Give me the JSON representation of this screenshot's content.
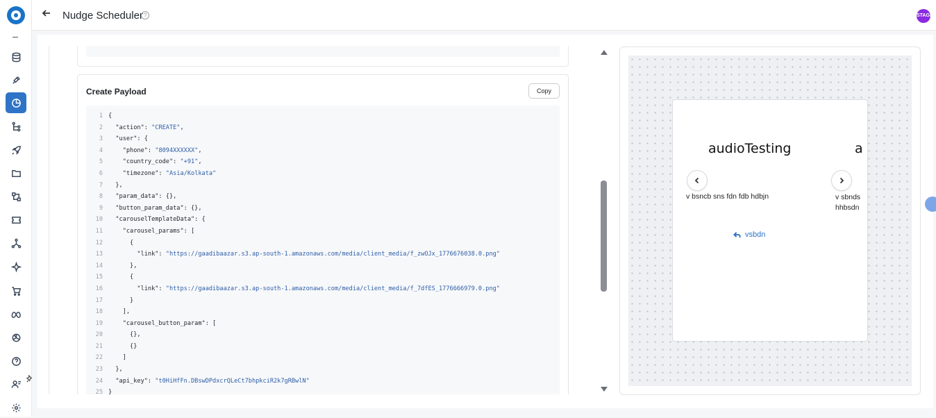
{
  "header": {
    "title": "Nudge Scheduler",
    "help": "?",
    "avatar_text": "STAGE"
  },
  "sidebar": {
    "items": [
      {
        "icon": "database-icon"
      },
      {
        "icon": "plug-icon"
      },
      {
        "icon": "pie-chart-icon",
        "active": true
      },
      {
        "icon": "flow-icon"
      },
      {
        "icon": "rocket-icon"
      },
      {
        "icon": "folder-icon"
      },
      {
        "icon": "workflow-icon"
      },
      {
        "icon": "ticket-icon"
      },
      {
        "icon": "network-icon"
      },
      {
        "icon": "sparkle-icon"
      },
      {
        "icon": "cart-icon"
      },
      {
        "icon": "meta-icon"
      },
      {
        "icon": "openai-icon"
      },
      {
        "icon": "help-icon"
      },
      {
        "icon": "agent-icon"
      },
      {
        "icon": "settings-icon"
      }
    ]
  },
  "payload": {
    "title": "Create Payload",
    "copy_label": "Copy",
    "lines": [
      {
        "n": "1",
        "parts": [
          [
            "k",
            "{"
          ]
        ]
      },
      {
        "n": "2",
        "parts": [
          [
            "k",
            "  \"action\": "
          ],
          [
            "s",
            "\"CREATE\""
          ],
          [
            "k",
            ","
          ]
        ]
      },
      {
        "n": "3",
        "parts": [
          [
            "k",
            "  \"user\": {"
          ]
        ]
      },
      {
        "n": "4",
        "parts": [
          [
            "k",
            "    \"phone\": "
          ],
          [
            "s",
            "\"8094XXXXXX\""
          ],
          [
            "k",
            ","
          ]
        ]
      },
      {
        "n": "5",
        "parts": [
          [
            "k",
            "    \"country_code\": "
          ],
          [
            "s",
            "\"+91\""
          ],
          [
            "k",
            ","
          ]
        ]
      },
      {
        "n": "6",
        "parts": [
          [
            "k",
            "    \"timezone\": "
          ],
          [
            "s",
            "\"Asia/Kolkata\""
          ]
        ]
      },
      {
        "n": "7",
        "parts": [
          [
            "k",
            "  },"
          ]
        ]
      },
      {
        "n": "8",
        "parts": [
          [
            "k",
            "  \"param_data\": {},"
          ]
        ]
      },
      {
        "n": "9",
        "parts": [
          [
            "k",
            "  \"button_param_data\": {},"
          ]
        ]
      },
      {
        "n": "10",
        "parts": [
          [
            "k",
            "  \"carouselTemplateData\": {"
          ]
        ]
      },
      {
        "n": "11",
        "parts": [
          [
            "k",
            "    \"carousel_params\": ["
          ]
        ]
      },
      {
        "n": "12",
        "parts": [
          [
            "k",
            "      {"
          ]
        ]
      },
      {
        "n": "13",
        "parts": [
          [
            "k",
            "        \"link\": "
          ],
          [
            "s",
            "\"https://gaadibaazar.s3.ap-south-1.amazonaws.com/media/client_media/f_zwOJx_1776676038.0.png\""
          ]
        ]
      },
      {
        "n": "14",
        "parts": [
          [
            "k",
            "      },"
          ]
        ]
      },
      {
        "n": "15",
        "parts": [
          [
            "k",
            "      {"
          ]
        ]
      },
      {
        "n": "16",
        "parts": [
          [
            "k",
            "        \"link\": "
          ],
          [
            "s",
            "\"https://gaadibaazar.s3.ap-south-1.amazonaws.com/media/client_media/f_7dfES_1776666979.0.png\""
          ]
        ]
      },
      {
        "n": "17",
        "parts": [
          [
            "k",
            "      }"
          ]
        ]
      },
      {
        "n": "18",
        "parts": [
          [
            "k",
            "    ],"
          ]
        ]
      },
      {
        "n": "19",
        "parts": [
          [
            "k",
            "    \"carousel_button_param\": ["
          ]
        ]
      },
      {
        "n": "20",
        "parts": [
          [
            "k",
            "      {},"
          ]
        ]
      },
      {
        "n": "21",
        "parts": [
          [
            "k",
            "      {}"
          ]
        ]
      },
      {
        "n": "22",
        "parts": [
          [
            "k",
            "    ]"
          ]
        ]
      },
      {
        "n": "23",
        "parts": [
          [
            "k",
            "  },"
          ]
        ]
      },
      {
        "n": "24",
        "parts": [
          [
            "k",
            "  \"api_key\": "
          ],
          [
            "s",
            "\"t0HiHfFn.DBswDPdxcrQLeCt7bhpkciR2k7gRBwlN\""
          ]
        ]
      },
      {
        "n": "25",
        "parts": [
          [
            "k",
            "}"
          ]
        ]
      }
    ]
  },
  "preview": {
    "card1_title": "audioTesting",
    "card1_text": "v bsncb sns fdn fdb hdbjn",
    "card1_button": "vsbdn",
    "card2_title": "a",
    "card2_text_line1": "v sbnds",
    "card2_text_line2": "hhbsdn"
  },
  "colors": {
    "accent": "#2f74c7",
    "code_string": "#2e5ea8"
  }
}
